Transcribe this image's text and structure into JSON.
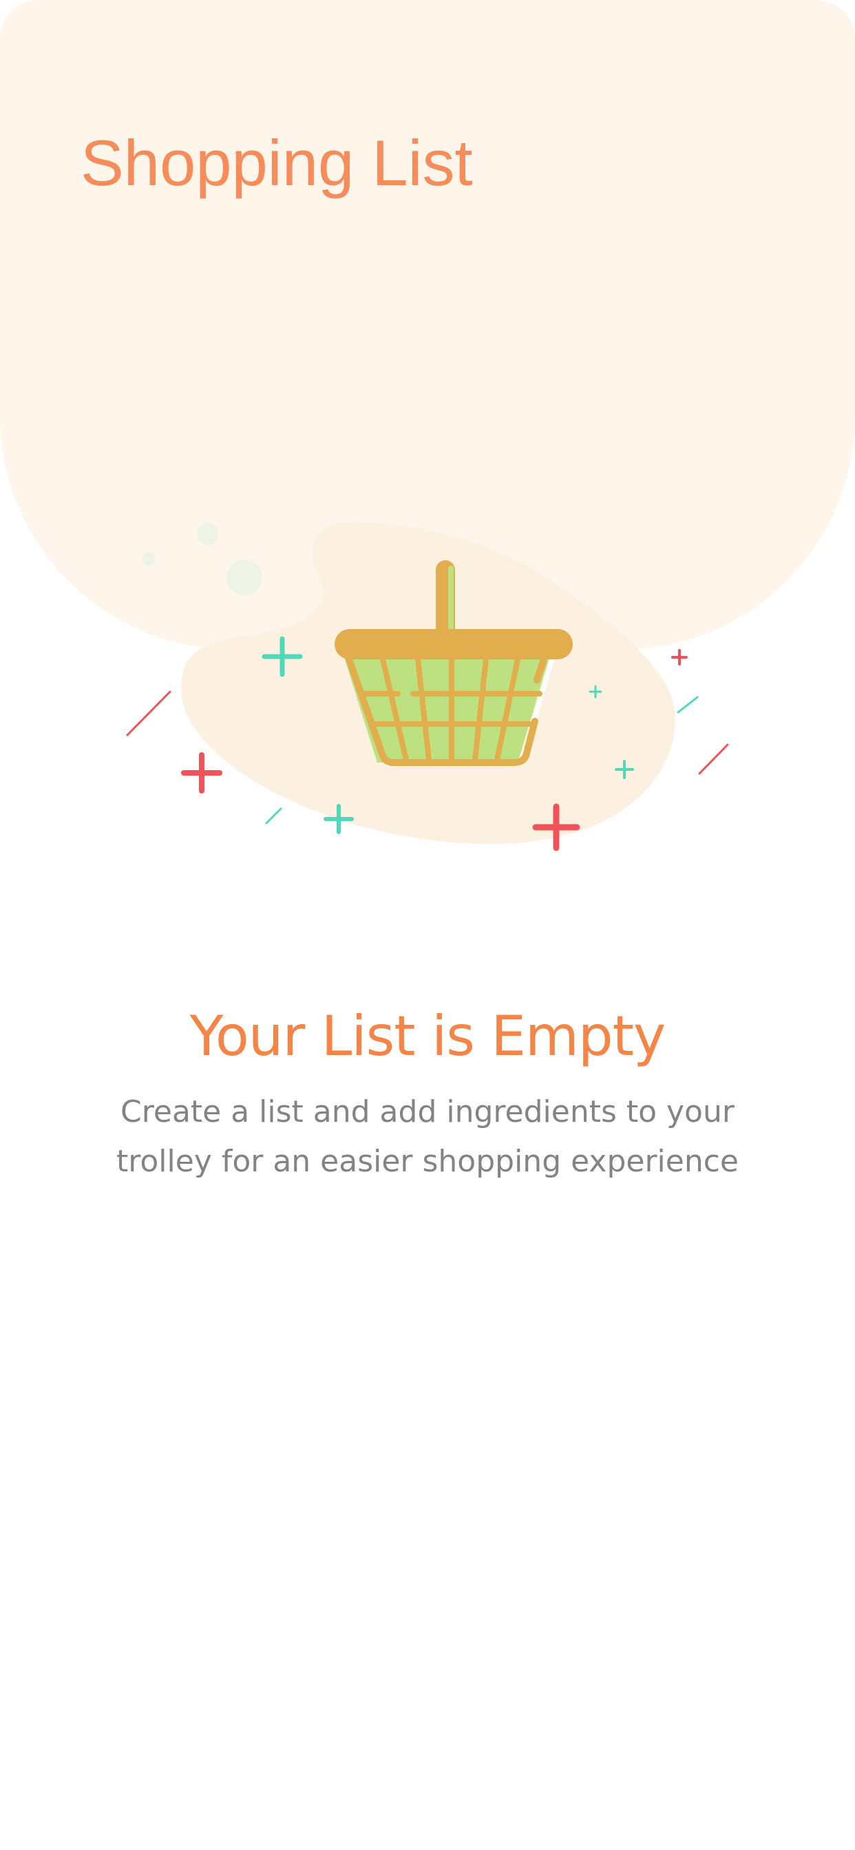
{
  "header": {
    "title": "Shopping List"
  },
  "illustration": {
    "icon": "basket-icon",
    "decorations": [
      "plus-icon",
      "slash-icon",
      "bubble"
    ]
  },
  "empty_state": {
    "title": "Your List is Empty",
    "subtitle": "Create a list and add ingredients to your trolley for an easier shopping experience"
  },
  "colors": {
    "background": "#ffffff",
    "header_background": "#fef5eb",
    "accent": "#f58447",
    "subtitle_text": "#838383",
    "basket_frame": "#e2ad4c",
    "basket_fill": "#bde081",
    "plus_red": "#f0525a",
    "plus_teal": "#4fd9b8"
  }
}
